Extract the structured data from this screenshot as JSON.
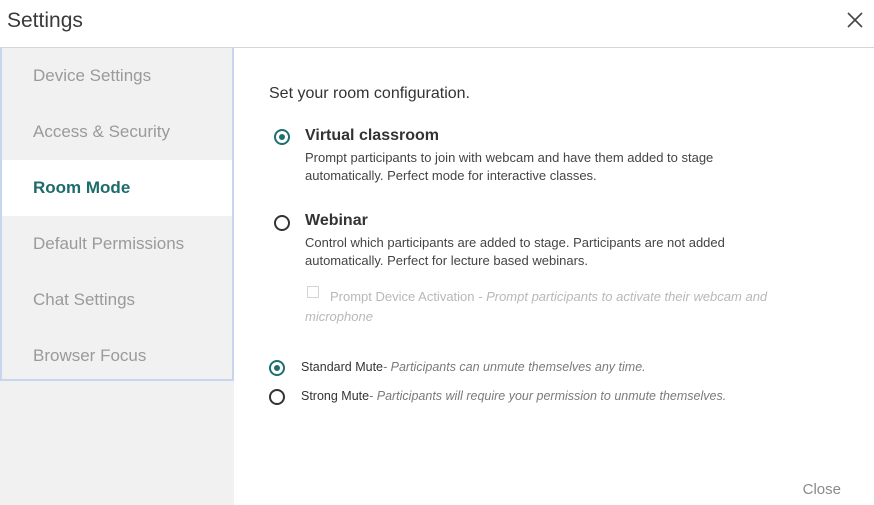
{
  "header": {
    "title": "Settings",
    "close_icon": "close-icon"
  },
  "sidebar": {
    "items": [
      {
        "label": "Device Settings"
      },
      {
        "label": "Access & Security"
      },
      {
        "label": "Room Mode",
        "active": true
      },
      {
        "label": "Default Permissions"
      },
      {
        "label": "Chat Settings"
      },
      {
        "label": "Browser Focus"
      }
    ]
  },
  "main": {
    "intro": "Set your room configuration.",
    "options": [
      {
        "title": "Virtual classroom",
        "desc": "Prompt participants to join with webcam and have them added to stage automatically. Perfect mode for interactive classes.",
        "selected": true
      },
      {
        "title": "Webinar",
        "desc": "Control which participants are added to stage. Participants are not added automatically. Perfect for lecture based webinars.",
        "selected": false
      }
    ],
    "checkbox": {
      "label": "Prompt Device Activation",
      "desc": " - Prompt participants to activate their webcam and microphone",
      "checked": false,
      "disabled": true
    },
    "mute": [
      {
        "label": "Standard Mute",
        "desc": "- Participants can unmute themselves any time.",
        "selected": true
      },
      {
        "label": "Strong Mute",
        "desc": "- Participants will require your permission to unmute themselves.",
        "selected": false
      }
    ]
  },
  "footer": {
    "close_label": "Close"
  },
  "colors": {
    "accent": "#1f6f6f",
    "sidebar_bg": "#f1f1f1",
    "sidebar_border": "#c6d6ef"
  }
}
